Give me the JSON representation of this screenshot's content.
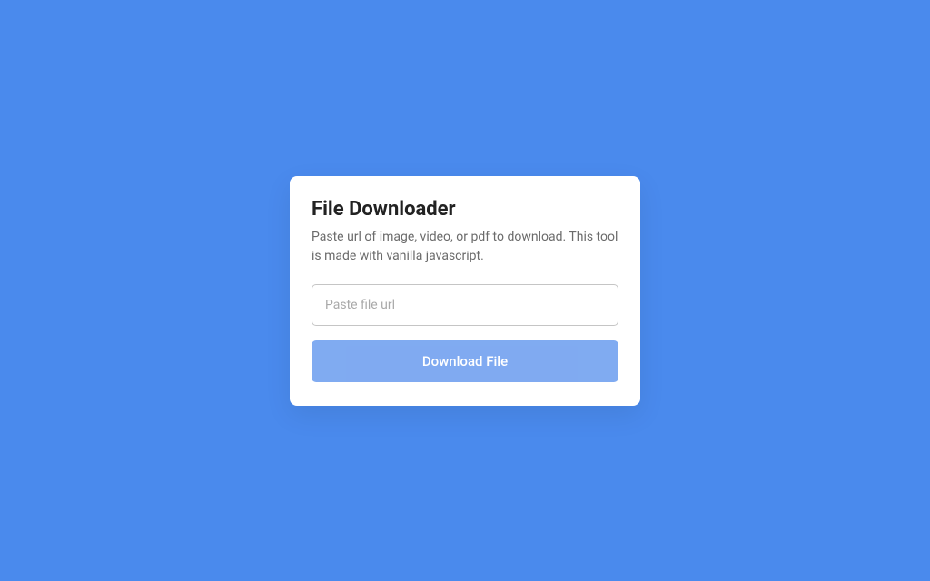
{
  "card": {
    "title": "File Downloader",
    "subtitle": "Paste url of image, video, or pdf to download. This tool is made with vanilla javascript.",
    "input": {
      "placeholder": "Paste file url",
      "value": ""
    },
    "button_label": "Download File"
  }
}
